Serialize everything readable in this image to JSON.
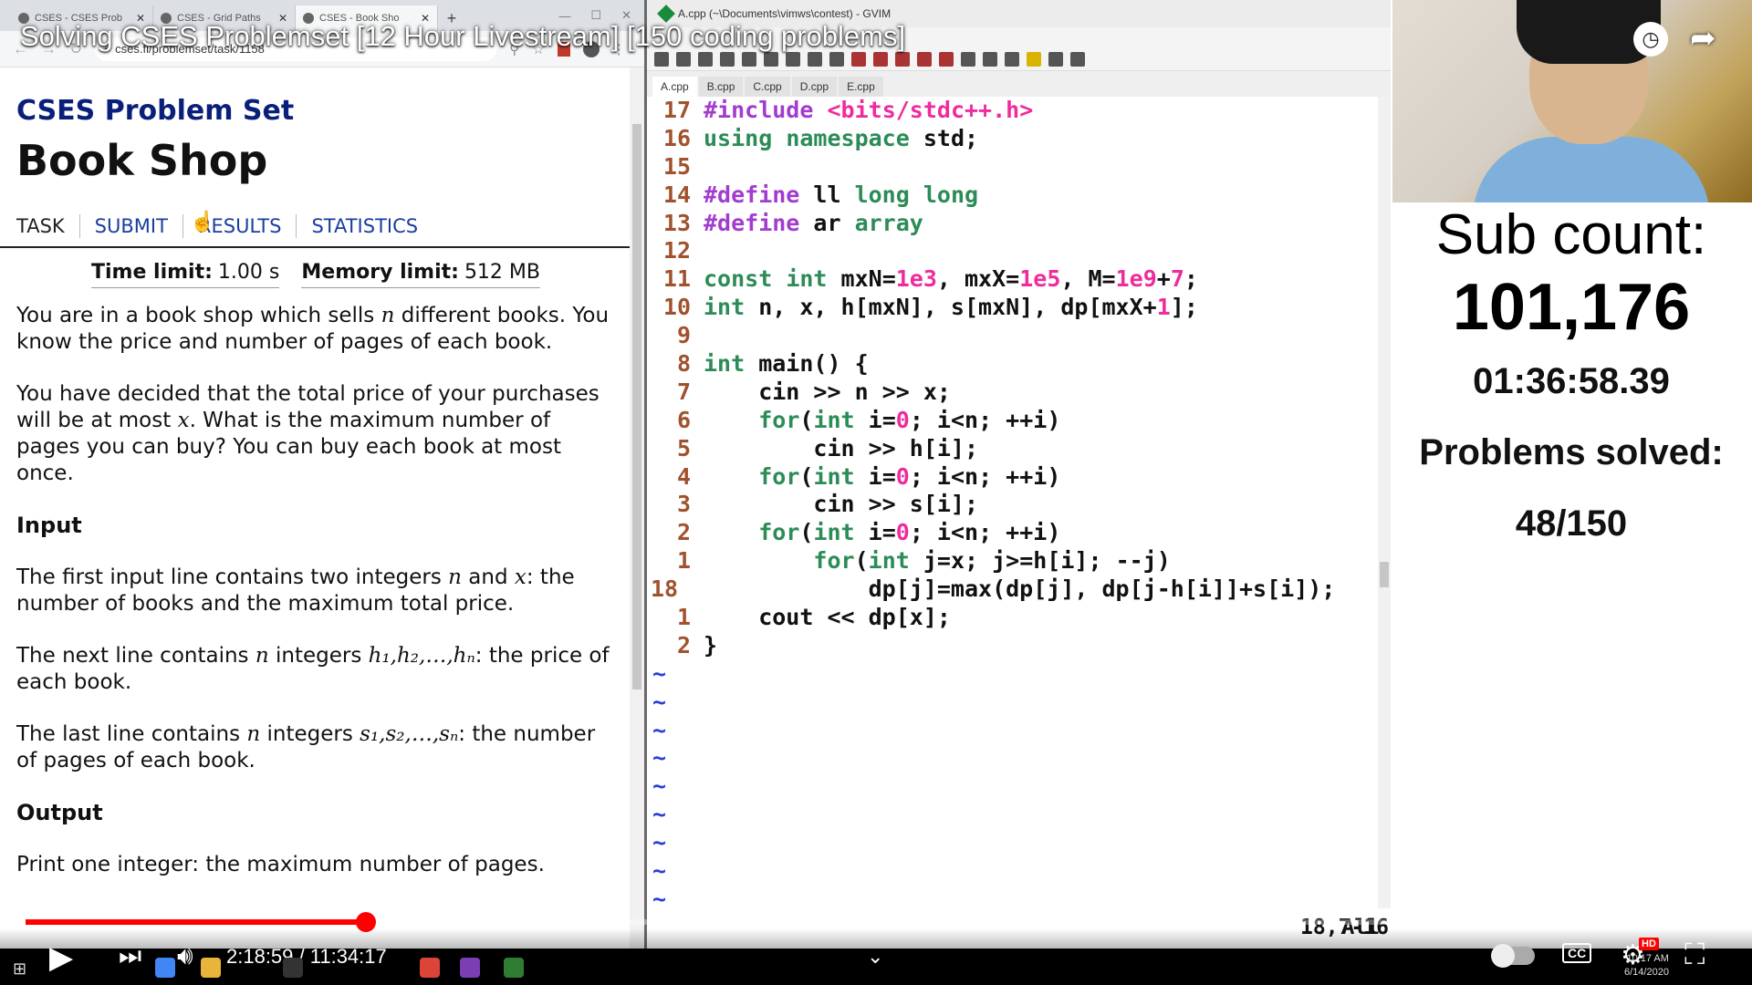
{
  "browser": {
    "tabs": [
      {
        "title": "CSES - CSES Prob"
      },
      {
        "title": "CSES - Grid Paths"
      },
      {
        "title": "CSES - Book Sho"
      }
    ],
    "url": "cses.fi/problemset/task/1158",
    "site_title": "CSES Problem Set",
    "page_title": "Book Shop",
    "page_tabs": [
      "TASK",
      "SUBMIT",
      "RESULTS",
      "STATISTICS"
    ],
    "time_limit_label": "Time limit:",
    "time_limit_value": "1.00 s",
    "memory_limit_label": "Memory limit:",
    "memory_limit_value": "512 MB",
    "p1a": "You are in a book shop which sells ",
    "p1b": " different books. You know the price and number of pages of each book.",
    "p2a": "You have decided that the total price of your purchases will be at most ",
    "p2b": ". What is the maximum number of pages you can buy? You can buy each book at most once.",
    "input_heading": "Input",
    "p3a": "The first input line contains two integers ",
    "p3b": " and ",
    "p3c": ": the number of books and the maximum total price.",
    "p4a": "The next line contains ",
    "p4b": " integers ",
    "p4c": ": the price of each book.",
    "p5a": "The last line contains ",
    "p5b": " integers ",
    "p5c": ": the number of pages of each book.",
    "output_heading": "Output",
    "p6": "Print one integer: the maximum number of pages.",
    "math_n": "n",
    "math_x": "x",
    "math_h_seq": "h₁,h₂,…,hₙ",
    "math_s_seq": "s₁,s₂,…,sₙ"
  },
  "gvim": {
    "title": "A.cpp (~\\Documents\\vimws\\contest) - GVIM",
    "tabs": [
      "A.cpp",
      "B.cpp",
      "C.cpp",
      "D.cpp",
      "E.cpp"
    ],
    "lines": [
      {
        "num": "17",
        "code": "#include <bits/stdc++.h>"
      },
      {
        "num": "16",
        "code": "using namespace std;"
      },
      {
        "num": "15",
        "code": ""
      },
      {
        "num": "14",
        "code": "#define ll long long"
      },
      {
        "num": "13",
        "code": "#define ar array"
      },
      {
        "num": "12",
        "code": ""
      },
      {
        "num": "11",
        "code": "const int mxN=1e3, mxX=1e5, M=1e9+7;"
      },
      {
        "num": "10",
        "code": "int n, x, h[mxN], s[mxN], dp[mxX+1];"
      },
      {
        "num": "9",
        "code": ""
      },
      {
        "num": "8",
        "code": "int main() {"
      },
      {
        "num": "7",
        "code": "    cin >> n >> x;"
      },
      {
        "num": "6",
        "code": "    for(int i=0; i<n; ++i)"
      },
      {
        "num": "5",
        "code": "        cin >> h[i];"
      },
      {
        "num": "4",
        "code": "    for(int i=0; i<n; ++i)"
      },
      {
        "num": "3",
        "code": "        cin >> s[i];"
      },
      {
        "num": "2",
        "code": "    for(int i=0; i<n; ++i)"
      },
      {
        "num": "1",
        "code": "        for(int j=x; j>=h[i]; --j)"
      },
      {
        "num": "18",
        "code": "            dp[j]=max(dp[j], dp[j-h[i]]+s[i]);"
      },
      {
        "num": "1",
        "code": "    cout << dp[x];"
      },
      {
        "num": "2",
        "code": "}"
      }
    ],
    "tilde_count": 9,
    "status_pos": "18,7-16",
    "status_all": "All"
  },
  "stream": {
    "sub_label": "Sub count:",
    "sub_count": "101,176",
    "timer": "01:36:58.39",
    "solved_label": "Problems solved:",
    "solved_value": "48/150"
  },
  "video": {
    "title": "Solving CSES Problemset [12 Hour Livestream] [150 coding problems]",
    "time": "2:18:59 / 11:34:17",
    "progress": 0.2,
    "hd": "HD",
    "cc": "CC"
  },
  "taskbar": {
    "date": "6/14/2020",
    "time": "10:17 AM"
  }
}
